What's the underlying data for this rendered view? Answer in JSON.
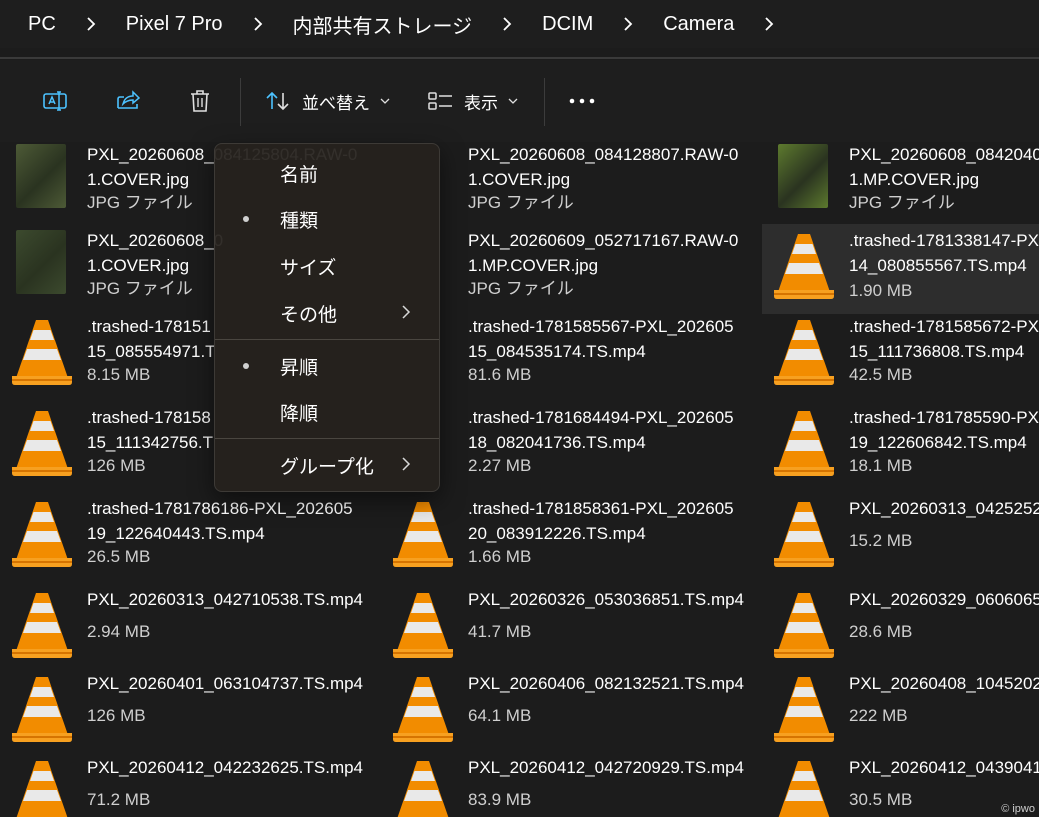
{
  "breadcrumb": [
    "PC",
    "Pixel 7 Pro",
    "内部共有ストレージ",
    "DCIM",
    "Camera"
  ],
  "toolbar": {
    "rename_icon": "rename-icon",
    "share_icon": "share-icon",
    "delete_icon": "trash-icon",
    "sort_label": "並べ替え",
    "view_label": "表示",
    "more_icon": "more-icon"
  },
  "sort_menu": {
    "items": [
      {
        "label": "名前",
        "checked": false,
        "submenu": false
      },
      {
        "label": "種類",
        "checked": true,
        "submenu": false
      },
      {
        "label": "サイズ",
        "checked": false,
        "submenu": false
      },
      {
        "label": "その他",
        "checked": false,
        "submenu": true
      },
      {
        "label": "昇順",
        "checked": true,
        "submenu": false
      },
      {
        "label": "降順",
        "checked": false,
        "submenu": false
      },
      {
        "label": "グループ化",
        "checked": false,
        "submenu": true
      }
    ]
  },
  "files": [
    {
      "name1": "PXL_20260608_084125804.RAW-0",
      "name2": "1.COVER.jpg",
      "sub": "JPG ファイル",
      "kind": "jpg",
      "thumb": "#4d5a36"
    },
    {
      "name1": "PXL_20260608_084128807.RAW-0",
      "name2": "1.COVER.jpg",
      "sub": "JPG ファイル",
      "kind": "none"
    },
    {
      "name1": "PXL_20260608_0842040",
      "name2": "1.MP.COVER.jpg",
      "sub": "JPG ファイル",
      "kind": "jpg",
      "thumb": "#5d7a2e"
    },
    {
      "name1": "PXL_20260608_0",
      "name2": "1.COVER.jpg",
      "sub": "JPG ファイル",
      "kind": "jpg",
      "thumb": "#3c4a2e"
    },
    {
      "name1": "PXL_20260609_052717167.RAW-0",
      "name2": "1.MP.COVER.jpg",
      "sub": "JPG ファイル",
      "kind": "none"
    },
    {
      "name1": ".trashed-1781338147-PX",
      "name2": "14_080855567.TS.mp4",
      "sub": "1.90 MB",
      "kind": "vlc",
      "selected": true
    },
    {
      "name1": ".trashed-178151",
      "name2": "15_085554971.T",
      "sub": "8.15 MB",
      "kind": "vlc"
    },
    {
      "name1": ".trashed-1781585567-PXL_202605",
      "name2": "15_084535174.TS.mp4",
      "sub": "81.6 MB",
      "kind": "none"
    },
    {
      "name1": ".trashed-1781585672-PX",
      "name2": "15_111736808.TS.mp4",
      "sub": "42.5 MB",
      "kind": "vlc"
    },
    {
      "name1": ".trashed-178158",
      "name2": "15_111342756.T",
      "sub": "126 MB",
      "kind": "vlc"
    },
    {
      "name1": ".trashed-1781684494-PXL_202605",
      "name2": "18_082041736.TS.mp4",
      "sub": "2.27 MB",
      "kind": "none"
    },
    {
      "name1": ".trashed-1781785590-PX",
      "name2": "19_122606842.TS.mp4",
      "sub": "18.1 MB",
      "kind": "vlc"
    },
    {
      "name1": ".trashed-1781786186-PXL_202605",
      "name2": "19_122640443.TS.mp4",
      "sub": "26.5 MB",
      "kind": "vlc"
    },
    {
      "name1": ".trashed-1781858361-PXL_202605",
      "name2": "20_083912226.TS.mp4",
      "sub": "1.66 MB",
      "kind": "vlc"
    },
    {
      "name1": "PXL_20260313_0425252",
      "name2": "",
      "sub": "15.2 MB",
      "kind": "vlc"
    },
    {
      "name1": "PXL_20260313_042710538.TS.mp4",
      "name2": "",
      "sub": "2.94 MB",
      "kind": "vlc"
    },
    {
      "name1": "PXL_20260326_053036851.TS.mp4",
      "name2": "",
      "sub": "41.7 MB",
      "kind": "vlc"
    },
    {
      "name1": "PXL_20260329_0606065",
      "name2": "",
      "sub": "28.6 MB",
      "kind": "vlc"
    },
    {
      "name1": "PXL_20260401_063104737.TS.mp4",
      "name2": "",
      "sub": "126 MB",
      "kind": "vlc"
    },
    {
      "name1": "PXL_20260406_082132521.TS.mp4",
      "name2": "",
      "sub": "64.1 MB",
      "kind": "vlc"
    },
    {
      "name1": "PXL_20260408_1045202",
      "name2": "",
      "sub": "222 MB",
      "kind": "vlc"
    },
    {
      "name1": "PXL_20260412_042232625.TS.mp4",
      "name2": "",
      "sub": "71.2 MB",
      "kind": "vlc"
    },
    {
      "name1": "PXL_20260412_042720929.TS.mp4",
      "name2": "",
      "sub": "83.9 MB",
      "kind": "vlc"
    },
    {
      "name1": "PXL_20260412_0439041",
      "name2": "",
      "sub": "30.5 MB",
      "kind": "vlc"
    }
  ],
  "watermark": "© ipwo",
  "colors": {
    "accent": "#4cc2ff",
    "cone_orange": "#f28c00",
    "selection": "#2d2d2d"
  }
}
